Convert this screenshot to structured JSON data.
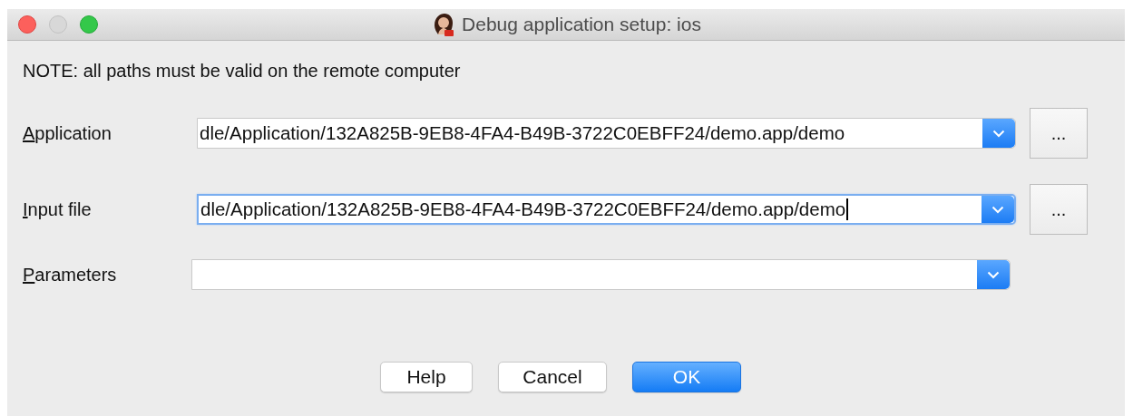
{
  "window": {
    "title": "Debug application setup: ios"
  },
  "note": "NOTE: all paths must be valid on the remote computer",
  "fields": [
    {
      "label": "Application",
      "mnemonic_underlined": true,
      "value": "dle/Application/132A825B-9EB8-4FA4-B49B-3722C0EBFF24/demo.app/demo",
      "focused": false,
      "browse": "..."
    },
    {
      "label": "Input file",
      "mnemonic_underlined": true,
      "value": "dle/Application/132A825B-9EB8-4FA4-B49B-3722C0EBFF24/demo.app/demo",
      "focused": true,
      "browse": "..."
    },
    {
      "label": "Parameters",
      "mnemonic_underlined": true,
      "focused": false
    }
  ],
  "buttons": [
    {
      "label": "Help",
      "default": false
    },
    {
      "label": "Cancel",
      "default": false
    },
    {
      "label": "OK",
      "default": true
    }
  ]
}
